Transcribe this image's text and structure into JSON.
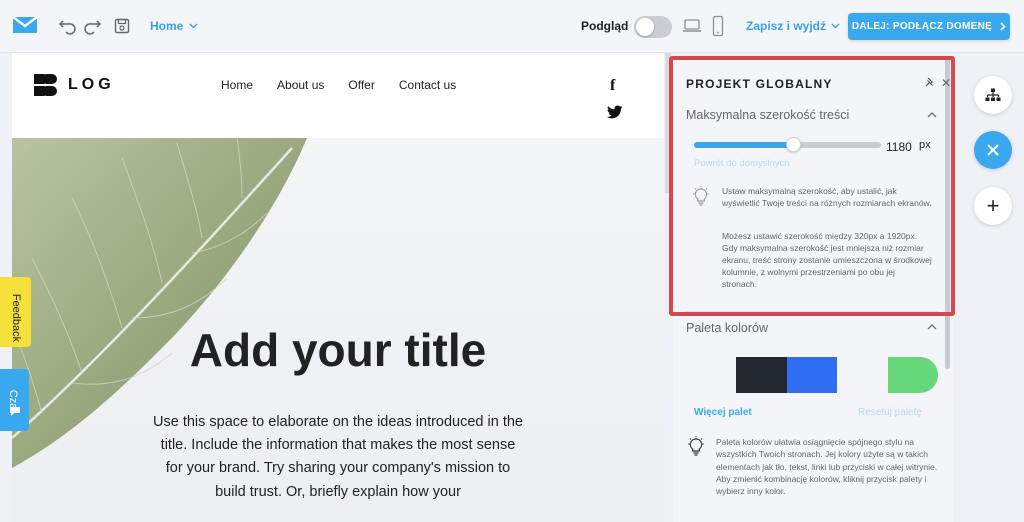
{
  "topbar": {
    "page_select": "Home",
    "preview_label": "Podgląd",
    "save_exit_label": "Zapisz i wyjdź",
    "next_button_label": "DALEJ: PODŁĄCZ DOMENĘ"
  },
  "site": {
    "brand": "LOG",
    "nav": [
      "Home",
      "About us",
      "Offer",
      "Contact us"
    ],
    "facebook_glyph": "f",
    "hero_title": "Add your title",
    "hero_body": "Use this space to elaborate on the ideas introduced in the title. Include the information that makes the most sense for your brand. Try sharing your company's mission to build trust. Or, briefly explain how your"
  },
  "side_tabs": {
    "feedback": "Feedback",
    "chat": "Czat"
  },
  "panel": {
    "title": "PROJEKT GLOBALNY",
    "width_section": {
      "heading": "Maksymalna szerokość treści",
      "value": "1180",
      "unit": "px",
      "slider_fraction": 0.53,
      "reset_label": "Powrót do domyślnych",
      "info_1": "Ustaw maksymalną szerokość, aby ustalić, jak wyświetlić Twoje treści na różnych rozmiarach ekranów.",
      "info_2": "Możesz ustawić szerokość między 320px a 1920px. Gdy maksymalna szerokość jest mniejsza niż rozmiar ekranu, treść strony zostanie umieszczona w środkowej kolumnie, z wolnymi przestrzeniami po obu jej stronach."
    },
    "palette_section": {
      "heading": "Paleta kolorów",
      "colors": [
        "#f4f5f7",
        "#232830",
        "#2f6ef0",
        "#f4f5f7",
        "#67d77b"
      ],
      "more_label": "Więcej palet",
      "reset_label": "Resetuj paletę",
      "info": "Paleta kolorów ułatwia osiągnięcie spójnego stylu na wszystkich Twoich stronach. Jej kolory użyte są w takich elementach jak tło, tekst, linki lub przyciski w całej witrynie. Aby zmienić kombinację kolorów, kliknij przycisk palety i wybierz inny kolor."
    }
  },
  "colors": {
    "accent": "#3aa8ef",
    "highlight": "#d6474e"
  }
}
